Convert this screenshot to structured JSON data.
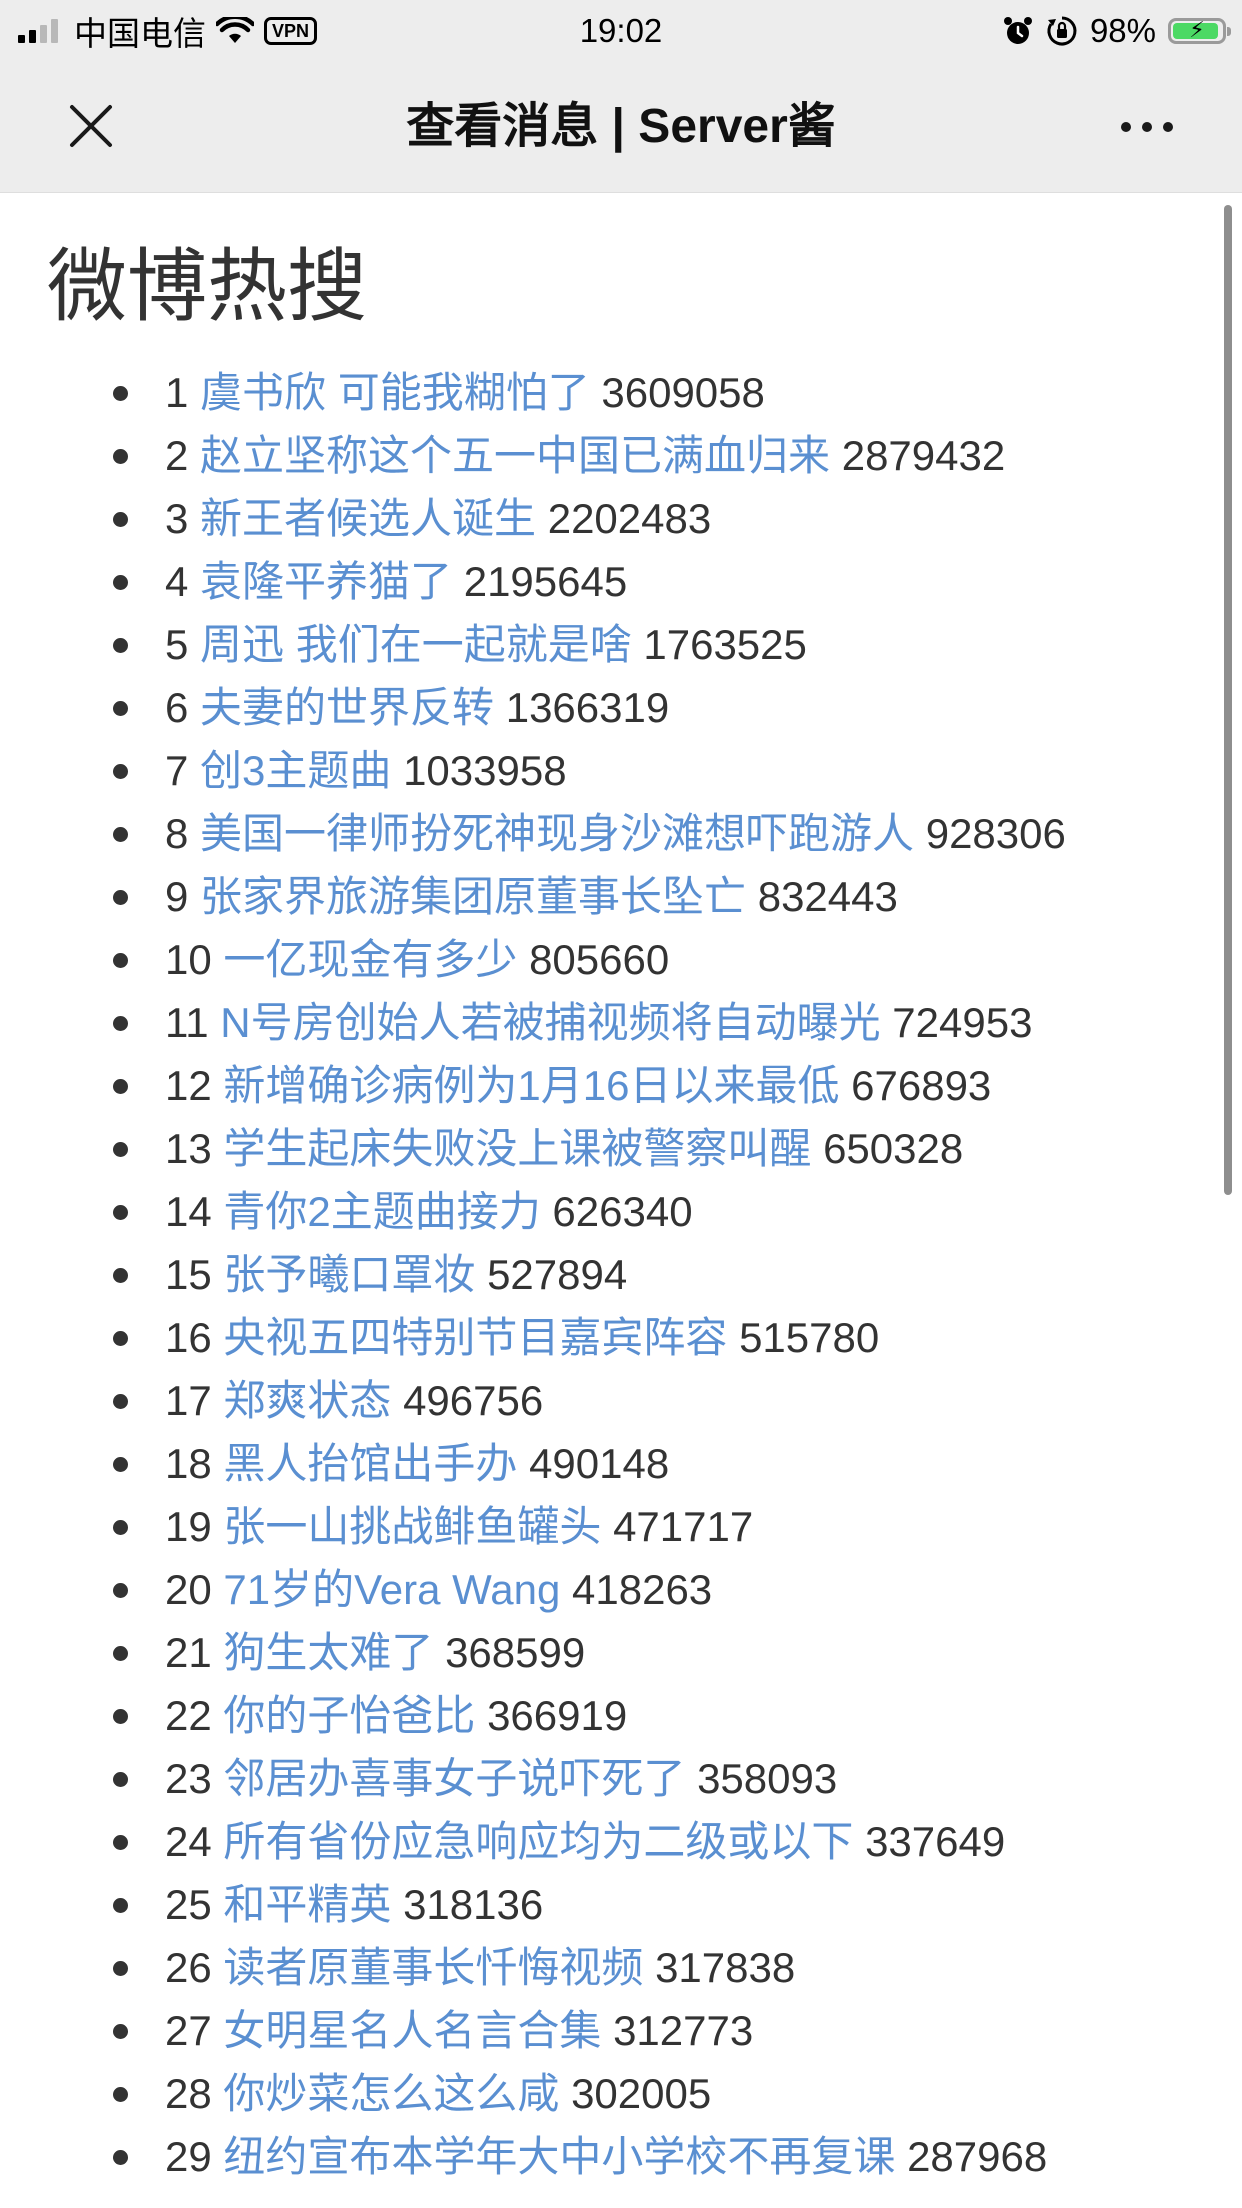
{
  "status_bar": {
    "carrier": "中国电信",
    "vpn": "VPN",
    "time": "19:02",
    "battery": "98%",
    "battery_level": 0.98,
    "icons": [
      "signal-icon",
      "wifi-icon",
      "alarm-icon",
      "rotation-lock-icon",
      "battery-charging-icon"
    ]
  },
  "nav": {
    "title": "查看消息 | Server酱",
    "close_icon": "close-icon",
    "more_icon": "more-icon"
  },
  "page": {
    "heading": "微博热搜"
  },
  "hot_list": [
    {
      "rank": "1",
      "title": "虞书欣 可能我糊怕了",
      "count": "3609058"
    },
    {
      "rank": "2",
      "title": "赵立坚称这个五一中国已满血归来",
      "count": "2879432"
    },
    {
      "rank": "3",
      "title": "新王者候选人诞生",
      "count": "2202483"
    },
    {
      "rank": "4",
      "title": "袁隆平养猫了",
      "count": "2195645"
    },
    {
      "rank": "5",
      "title": "周迅 我们在一起就是啥",
      "count": "1763525"
    },
    {
      "rank": "6",
      "title": "夫妻的世界反转",
      "count": "1366319"
    },
    {
      "rank": "7",
      "title": "创3主题曲",
      "count": "1033958"
    },
    {
      "rank": "8",
      "title": "美国一律师扮死神现身沙滩想吓跑游人",
      "count": "928306"
    },
    {
      "rank": "9",
      "title": "张家界旅游集团原董事长坠亡",
      "count": "832443"
    },
    {
      "rank": "10",
      "title": "一亿现金有多少",
      "count": "805660"
    },
    {
      "rank": "11",
      "title": "N号房创始人若被捕视频将自动曝光",
      "count": "724953"
    },
    {
      "rank": "12",
      "title": "新增确诊病例为1月16日以来最低",
      "count": "676893"
    },
    {
      "rank": "13",
      "title": "学生起床失败没上课被警察叫醒",
      "count": "650328"
    },
    {
      "rank": "14",
      "title": "青你2主题曲接力",
      "count": "626340"
    },
    {
      "rank": "15",
      "title": "张予曦口罩妆",
      "count": "527894"
    },
    {
      "rank": "16",
      "title": "央视五四特别节目嘉宾阵容",
      "count": "515780"
    },
    {
      "rank": "17",
      "title": "郑爽状态",
      "count": "496756"
    },
    {
      "rank": "18",
      "title": "黑人抬馆出手办",
      "count": "490148"
    },
    {
      "rank": "19",
      "title": "张一山挑战鲱鱼罐头",
      "count": "471717"
    },
    {
      "rank": "20",
      "title": "71岁的Vera Wang",
      "count": "418263"
    },
    {
      "rank": "21",
      "title": "狗生太难了",
      "count": "368599"
    },
    {
      "rank": "22",
      "title": "你的子怡爸比",
      "count": "366919"
    },
    {
      "rank": "23",
      "title": "邻居办喜事女子说吓死了",
      "count": "358093"
    },
    {
      "rank": "24",
      "title": "所有省份应急响应均为二级或以下",
      "count": "337649"
    },
    {
      "rank": "25",
      "title": "和平精英",
      "count": "318136"
    },
    {
      "rank": "26",
      "title": "读者原董事长忏悔视频",
      "count": "317838"
    },
    {
      "rank": "27",
      "title": "女明星名人名言合集",
      "count": "312773"
    },
    {
      "rank": "28",
      "title": "你炒菜怎么这么咸",
      "count": "302005"
    },
    {
      "rank": "29",
      "title": "纽约宣布本学年大中小学校不再复课",
      "count": "287968"
    }
  ],
  "colors": {
    "link": "#5a8fd1",
    "text": "#333333",
    "bar_bg": "#ededed",
    "battery_fill": "#4cd964"
  }
}
